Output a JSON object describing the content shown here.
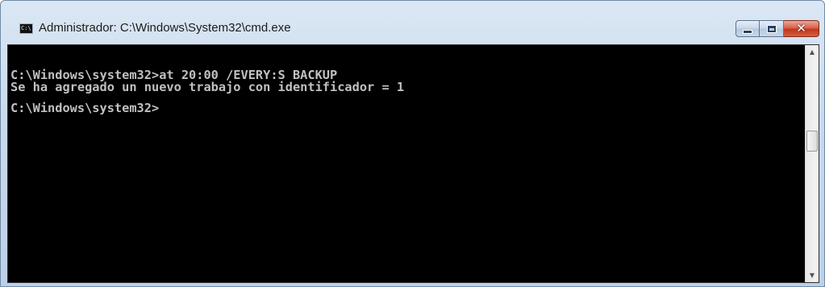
{
  "window": {
    "title": "Administrador: C:\\Windows\\System32\\cmd.exe",
    "icon": "cmd-icon",
    "icon_text": "C:\\",
    "controls": {
      "minimize_icon": "minimize-icon",
      "maximize_icon": "maximize-icon",
      "close_icon": "close-icon",
      "close_glyph": "✕"
    }
  },
  "console": {
    "lines": [
      "C:\\Windows\\system32>at 20:00 /EVERY:S BACKUP",
      "Se ha agregado un nuevo trabajo con identificador = 1",
      "",
      "C:\\Windows\\system32>"
    ],
    "background": "#000000",
    "foreground": "#c0c0c0"
  },
  "scrollbar": {
    "up_glyph": "▲",
    "down_glyph": "▼"
  }
}
